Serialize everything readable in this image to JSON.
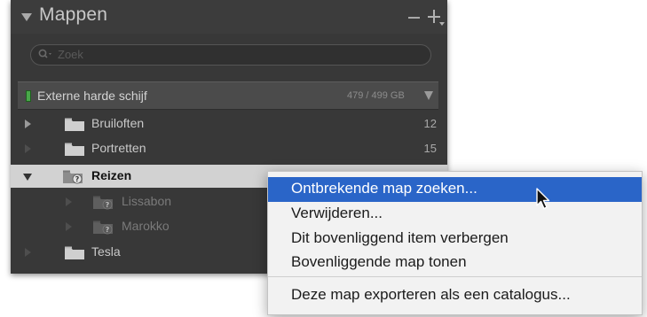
{
  "panel": {
    "title": "Mappen",
    "minus_label": "−",
    "plus_label": "+",
    "search": {
      "placeholder": "Zoek"
    },
    "volume": {
      "name": "Externe harde schijf",
      "usage": "479 / 499 GB",
      "status_color": "#49a84a"
    },
    "folders": [
      {
        "name": "Bruiloften",
        "count": "12",
        "state": "collapsed"
      },
      {
        "name": "Portretten",
        "count": "15",
        "state": "empty"
      },
      {
        "name": "Reizen",
        "count": "",
        "state": "expanded",
        "selected": true,
        "missing": true
      },
      {
        "name": "Lissabon",
        "count": "",
        "state": "child",
        "missing": true
      },
      {
        "name": "Marokko",
        "count": "",
        "state": "child",
        "missing": true
      },
      {
        "name": "Tesla",
        "count": "",
        "state": "empty"
      }
    ]
  },
  "context_menu": {
    "items": [
      {
        "label": "Ontbrekende map zoeken...",
        "highlighted": true
      },
      {
        "label": "Verwijderen..."
      },
      {
        "label": "Dit bovenliggend item verbergen"
      },
      {
        "label": "Bovenliggende map tonen"
      },
      {
        "label": "Deze map exporteren als een catalogus..."
      }
    ],
    "highlight_color": "#2a65c8"
  }
}
